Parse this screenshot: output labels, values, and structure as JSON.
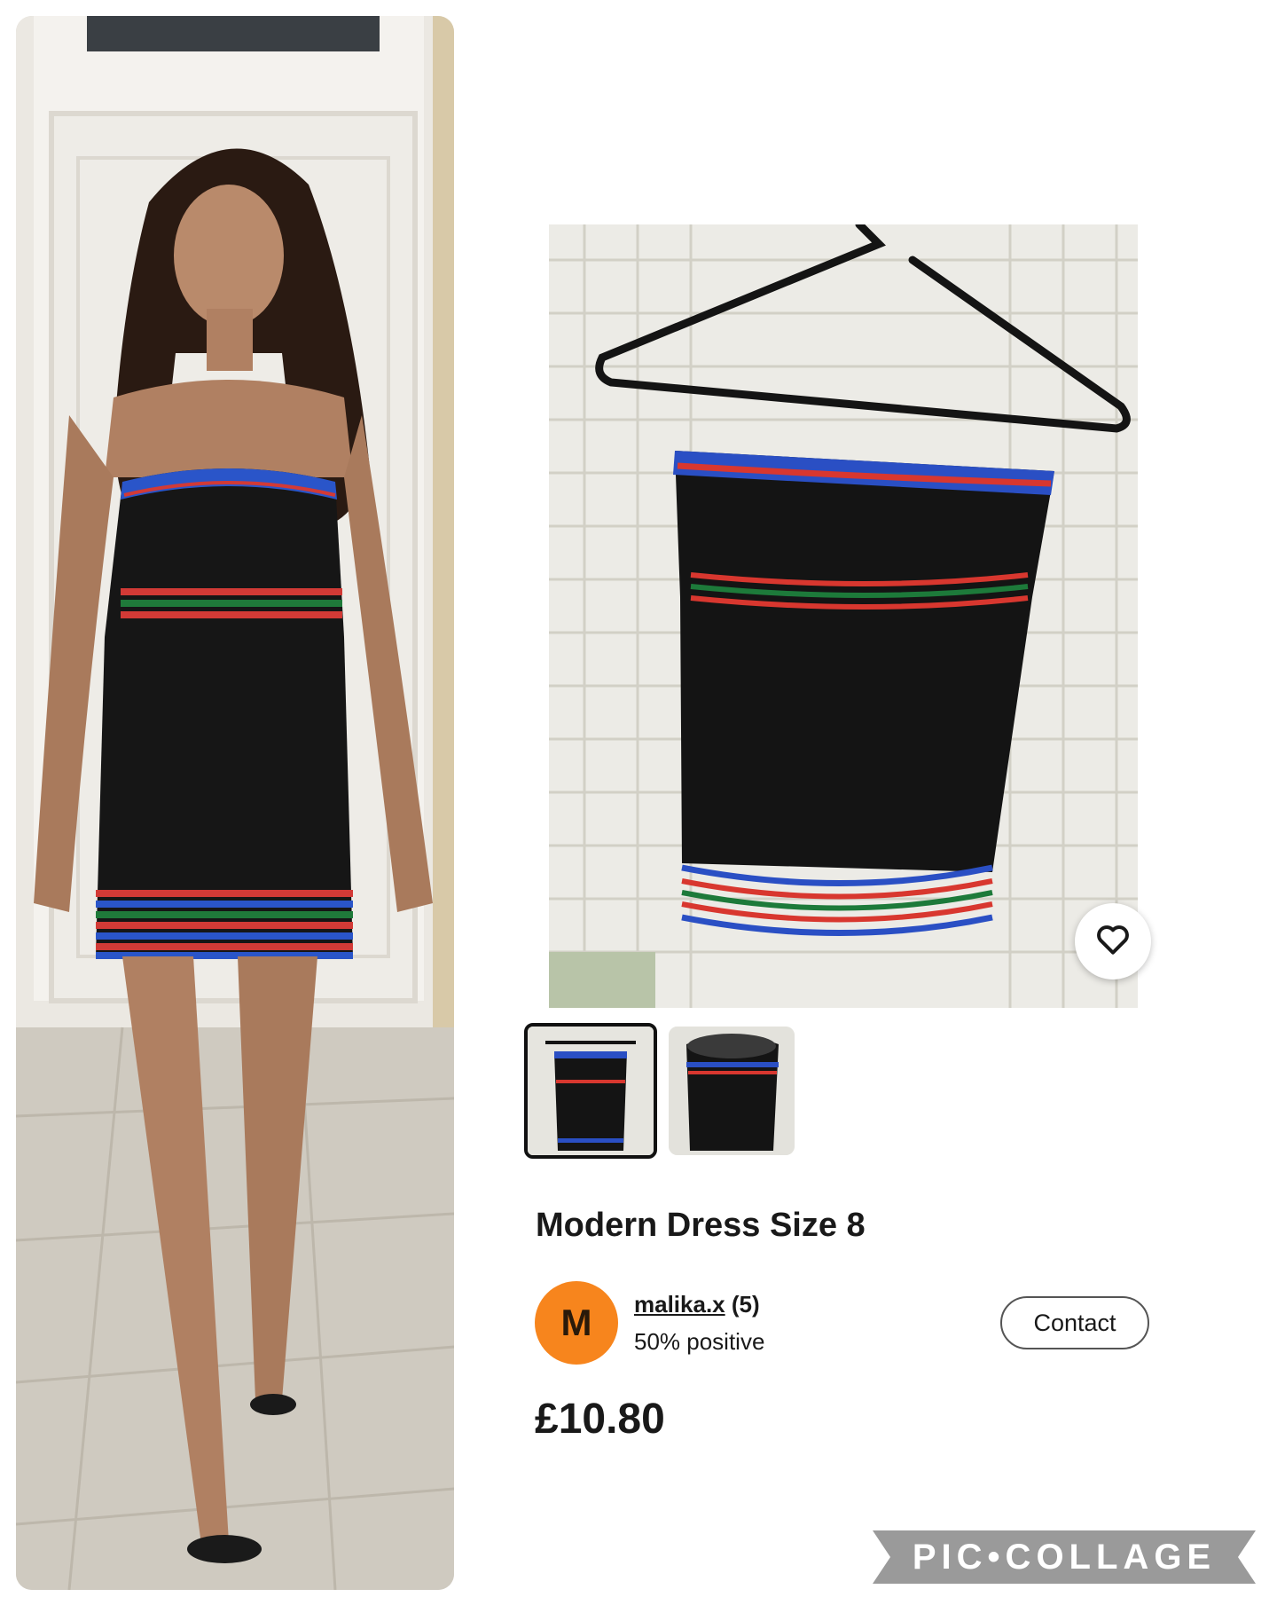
{
  "listing": {
    "title": "Modern Dress Size 8",
    "price": "£10.80"
  },
  "seller": {
    "avatar_letter": "M",
    "name": "malika.x",
    "rating_count": "(5)",
    "feedback": "50% positive",
    "avatar_color": "#f7851d"
  },
  "actions": {
    "contact_label": "Contact"
  },
  "gallery": {
    "thumbnails": [
      "dress-front-on-hanger",
      "dress-inside-view"
    ],
    "selected_index": 0
  },
  "watermark": {
    "text": "PIC•COLLAGE"
  },
  "icons": {
    "favorite": "heart-outline-icon"
  }
}
